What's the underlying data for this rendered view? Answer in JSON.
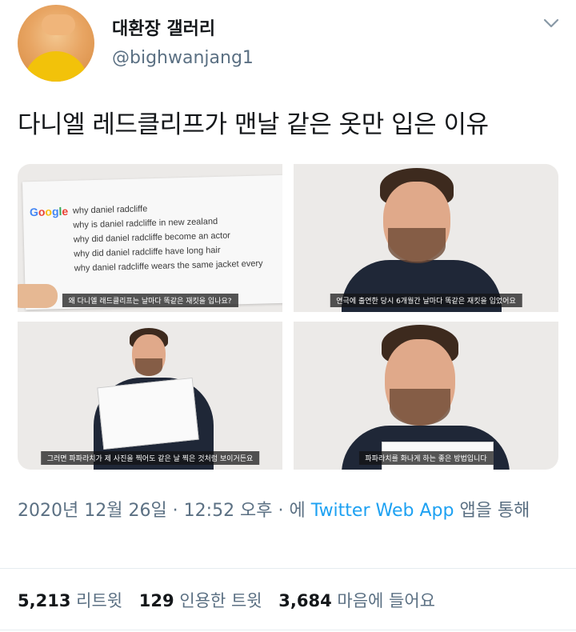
{
  "user": {
    "display_name": "대환장 갤러리",
    "handle": "@bighwanjang1"
  },
  "tweet": {
    "text": "다니엘 레드클리프가 맨날 같은 옷만 입은 이유"
  },
  "media": {
    "tile1": {
      "logo": "Google",
      "suggestions": [
        "why daniel radcliffe",
        "why is daniel radcliffe in new zealand",
        "why did daniel radcliffe become an actor",
        "why did daniel radcliffe have long hair",
        "why daniel radcliffe wears the same jacket every"
      ],
      "subtitle": "왜 다니엘 래드클리프는 날마다 똑같은 재킷을 입나요?"
    },
    "tile2": {
      "subtitle": "연극에 출연한 당시 6개월간 날마다 똑같은 재킷을 입었어요"
    },
    "tile3": {
      "subtitle": "그러면 파파라치가 제 사진을 찍어도 같은 날 찍은 것처럼 보이거든요"
    },
    "tile4": {
      "subtitle": "파파라치를 화나게 하는 좋은 방법입니다"
    }
  },
  "meta": {
    "timestamp": "2020년 12월 26일 · 12:52 오후 · 에",
    "client": "Twitter Web App",
    "suffix": "앱을 통해"
  },
  "stats": {
    "retweets": "5,213",
    "retweets_label": "리트윗",
    "quotes": "129",
    "quotes_label": "인용한 트윗",
    "likes": "3,684",
    "likes_label": "마음에 들어요"
  },
  "colors": {
    "accent": "#1da1f2",
    "secondary_text": "#5b7083",
    "primary_text": "#14171a"
  }
}
